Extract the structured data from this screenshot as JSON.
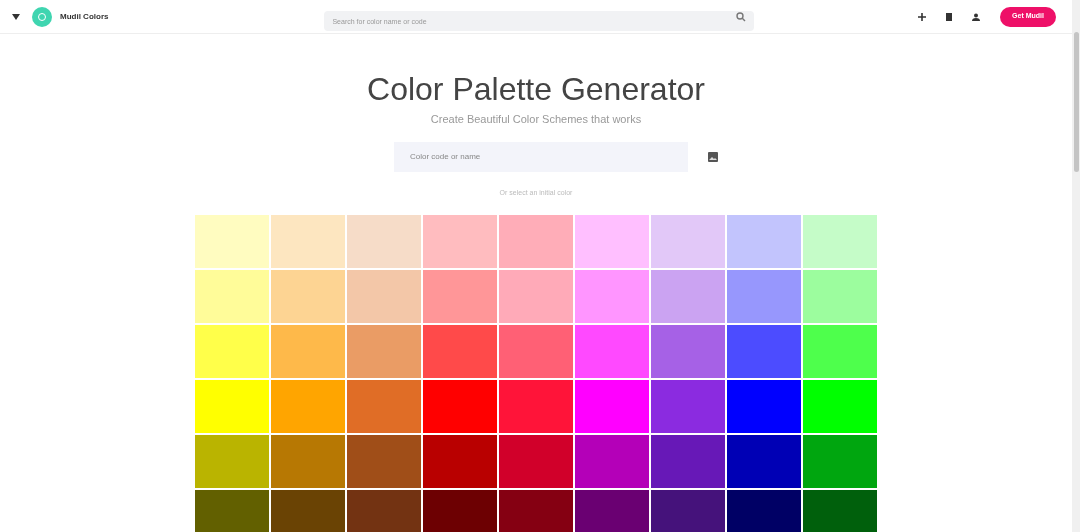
{
  "header": {
    "brand": "Mudil Colors",
    "search": {
      "placeholder": "Search for color name or code"
    },
    "cta": "Get Mudil"
  },
  "hero": {
    "title": "Color Palette Generator",
    "subtitle": "Create Beautiful Color Schemes that works",
    "input": {
      "placeholder": "Color code or name"
    },
    "hint": "Or select an initial color"
  },
  "swatches": [
    [
      {
        "color": "#fffcc0"
      },
      {
        "color": "#fde6c0"
      },
      {
        "color": "#f6dcc8"
      },
      {
        "color": "#ffbcbf"
      },
      {
        "color": "#ffadb8"
      },
      {
        "color": "#ffbfff"
      },
      {
        "color": "#e2c8f8"
      },
      {
        "color": "#c2c4fd"
      },
      {
        "color": "#c5fcc8"
      }
    ],
    [
      {
        "color": "#fffc99"
      },
      {
        "color": "#fdd493"
      },
      {
        "color": "#f3c7a8"
      },
      {
        "color": "#ff9698"
      },
      {
        "color": "#ffaab8"
      },
      {
        "color": "#ff95ff"
      },
      {
        "color": "#cba3f2"
      },
      {
        "color": "#9797fd"
      },
      {
        "color": "#9cfd9e"
      }
    ],
    [
      {
        "color": "#ffff4a"
      },
      {
        "color": "#feb94a"
      },
      {
        "color": "#ea9c65"
      },
      {
        "color": "#ff4a4a"
      },
      {
        "color": "#ff6075"
      },
      {
        "color": "#ff49ff"
      },
      {
        "color": "#a661e6"
      },
      {
        "color": "#4c4cff"
      },
      {
        "color": "#4eff4c"
      }
    ],
    [
      {
        "color": "#ffff00"
      },
      {
        "color": "#ffa500"
      },
      {
        "color": "#e06d26"
      },
      {
        "color": "#ff0000"
      },
      {
        "color": "#ff1439"
      },
      {
        "color": "#ff00ff"
      },
      {
        "color": "#8b2be0"
      },
      {
        "color": "#0000ff"
      },
      {
        "color": "#00ff00"
      }
    ],
    [
      {
        "color": "#bab400"
      },
      {
        "color": "#b77803"
      },
      {
        "color": "#a04e18"
      },
      {
        "color": "#b90000"
      },
      {
        "color": "#d1002a"
      },
      {
        "color": "#b400b8"
      },
      {
        "color": "#6718b7"
      },
      {
        "color": "#0000b5"
      },
      {
        "color": "#00a60f"
      }
    ],
    [
      {
        "color": "#626000"
      },
      {
        "color": "#6a4304"
      },
      {
        "color": "#733312"
      },
      {
        "color": "#6d0002"
      },
      {
        "color": "#850012"
      },
      {
        "color": "#6a0072"
      },
      {
        "color": "#45127b"
      },
      {
        "color": "#000065"
      },
      {
        "color": "#00600c"
      }
    ]
  ]
}
